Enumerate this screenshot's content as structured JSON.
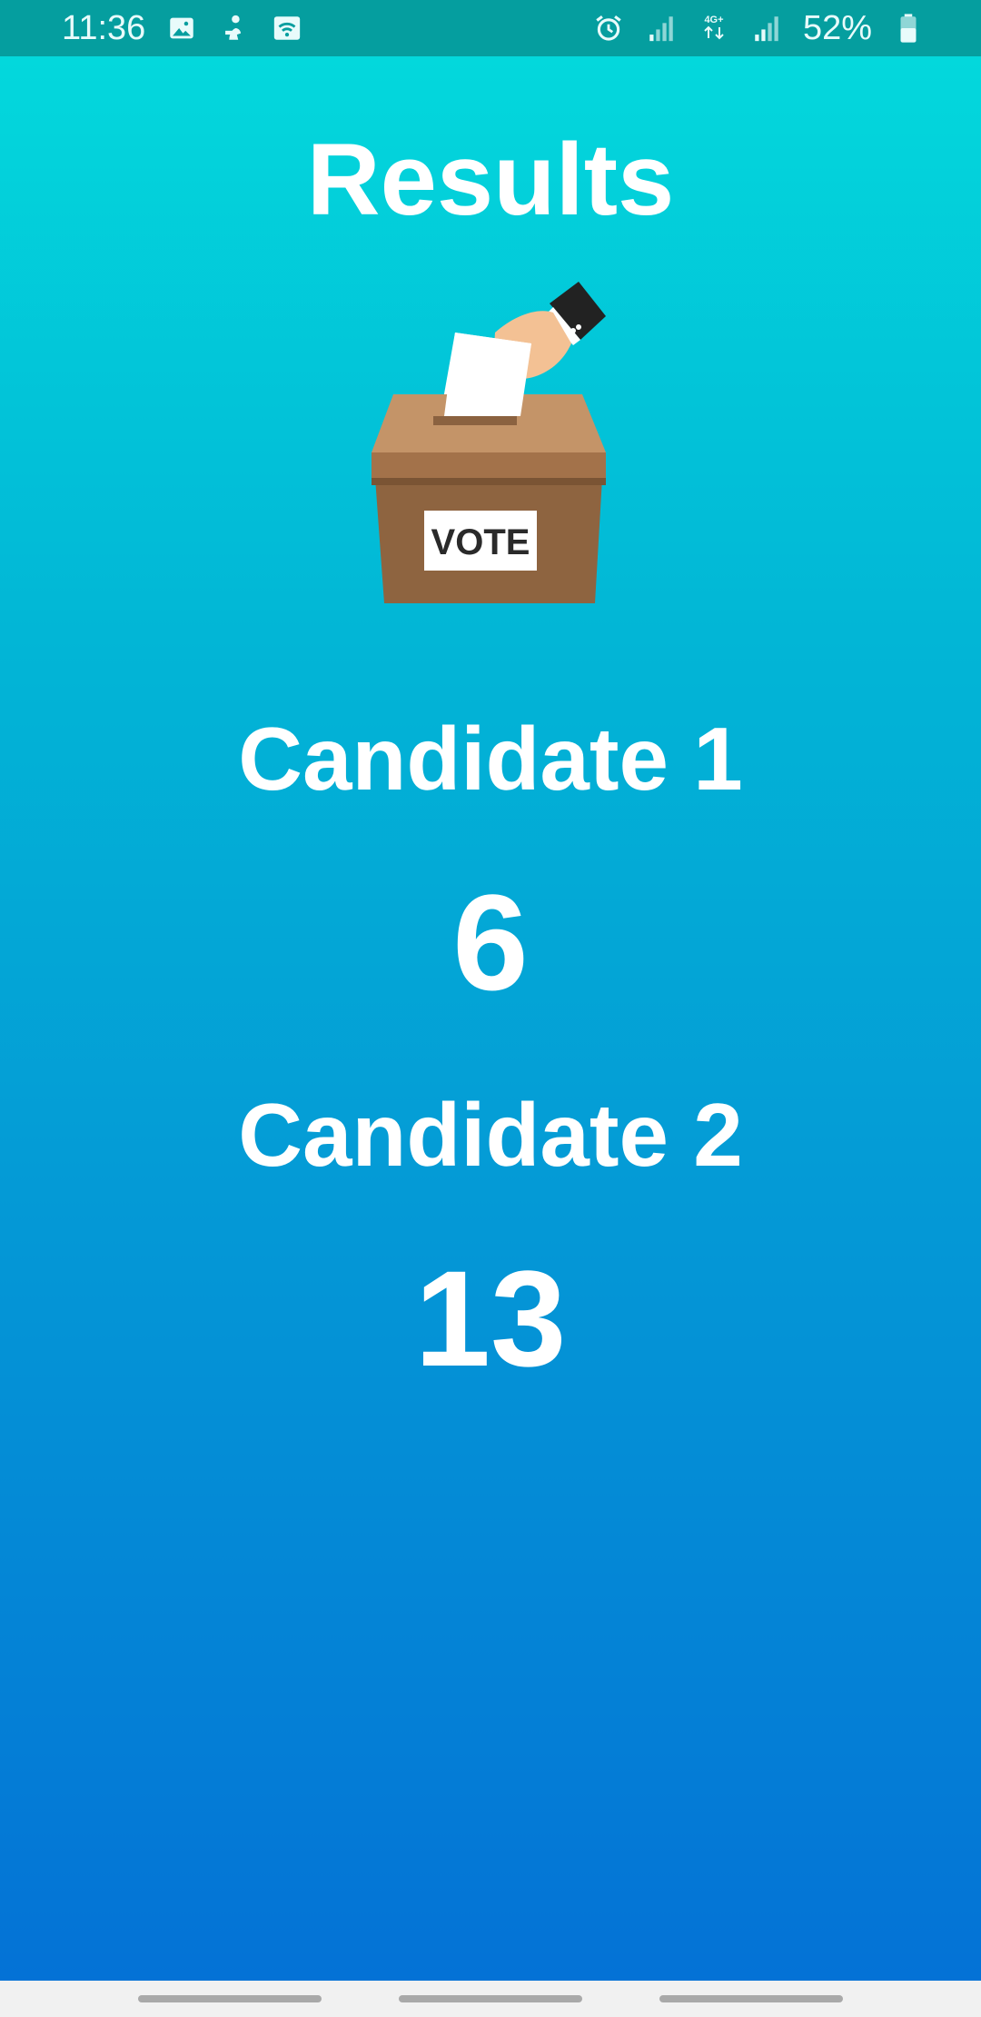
{
  "status_bar": {
    "time": "11:36",
    "network": "4G+",
    "battery": "52%",
    "left_icons": [
      "gallery-icon",
      "person-notification-icon",
      "wifi-hotspot-icon"
    ],
    "right_icons": [
      "alarm-icon",
      "signal-icon",
      "network-4g-icon",
      "signal-icon",
      "battery-icon"
    ]
  },
  "page": {
    "title": "Results",
    "illustration_label": "VOTE"
  },
  "candidates": [
    {
      "name": "Candidate 1",
      "votes": "6"
    },
    {
      "name": "Candidate 2",
      "votes": "13"
    }
  ],
  "colors": {
    "status_bar": "#059e9f",
    "gradient_top": "#03d8dc",
    "gradient_bottom": "#0472d6",
    "text": "#ffffff",
    "nav_bar": "#f1f1f1"
  }
}
